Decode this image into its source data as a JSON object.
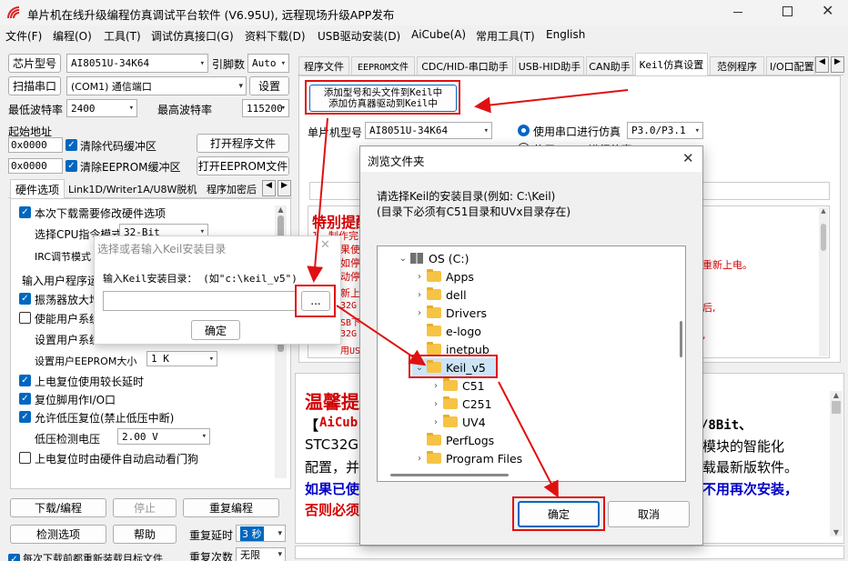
{
  "window": {
    "title": "单片机在线升级编程仿真调试平台软件 (V6.95U), 远程现场升级APP发布"
  },
  "menu": [
    "文件(F)",
    "编程(O)",
    "工具(T)",
    "调试仿真接口(G)",
    "资料下载(D)",
    "USB驱动安装(D)",
    "AiCube(A)",
    "常用工具(T)",
    "English"
  ],
  "left": {
    "chip_label": "芯片型号",
    "chip_value": "AI8051U-34K64",
    "pins_label": "引脚数",
    "pins_value": "Auto",
    "scan_btn": "扫描串口",
    "port_value": "(COM1) 通信端口",
    "settings_btn": "设置",
    "min_baud_label": "最低波特率",
    "min_baud": "2400",
    "max_baud_label": "最高波特率",
    "max_baud": "115200",
    "start_addr_label": "起始地址",
    "addr1": "0x0000",
    "clear_code": "清除代码缓冲区",
    "open_prog": "打开程序文件",
    "addr2": "0x0000",
    "clear_eeprom": "清除EEPROM缓冲区",
    "open_eeprom": "打开EEPROM文件",
    "tabs": [
      "硬件选项",
      "Link1D/Writer1A/U8W脱机",
      "程序加密后"
    ],
    "opts": {
      "o1": "本次下载需要修改硬件选项",
      "cpu_label": "选择CPU指令模式",
      "cpu_value": "32-Bit",
      "irc_label": "IRC调节模式",
      "input_prog": "输入用户程序运",
      "amp": "振荡器放大增",
      "enable_sys": "使能用户系统",
      "set_sys": "设置用户系统",
      "eeprom_label": "设置用户EEPROM大小",
      "eeprom_value": "1 K",
      "delay": "上电复位使用较长延时",
      "reset_io": "复位脚用作I/O口",
      "lvr": "允许低压复位(禁止低压中断)",
      "lv_label": "低压检测电压",
      "lv_value": "2.00 V",
      "wdt": "上电复位时由硬件自动启动看门狗"
    },
    "bottom": {
      "download": "下载/编程",
      "stop": "停止",
      "reprogram": "重复编程",
      "detect": "检测选项",
      "help": "帮助",
      "delay_label": "重复延时",
      "delay_value": "3 秒",
      "count_label": "重复次数",
      "count_value": "无限",
      "reload": "每次下载前都重新装载目标文件"
    }
  },
  "right": {
    "tabs": [
      "程序文件",
      "EEPROM文件",
      "CDC/HID-串口助手",
      "USB-HID助手",
      "CAN助手",
      "Keil仿真设置",
      "范例程序",
      "I/O口配置"
    ],
    "add_btn_l1": "添加型号和头文件到Keil中",
    "add_btn_l2": "添加仿真器驱动到Keil中",
    "mcu_label": "单片机型号",
    "mcu_value": "AI8051U-34K64",
    "radio1": "使用串口进行仿真",
    "radio1_sel": "P3.0/P3.1",
    "radio2": "使用USB口进行仿真",
    "notice_title": "特别提醒",
    "notice_lines": [
      "1、制作完",
      "果使",
      "如停",
      "动停",
      "新上",
      "32G",
      "SB下",
      "32G",
      "用US"
    ],
    "notice_right": [
      "重新上电。",
      "后,",
      ","
    ],
    "tips_title": "温馨提",
    "tips_l1a": "【",
    "tips_l1b": "AiCub",
    "tips_l1c": "/8Bit、",
    "tips_l2a": "STC32G1",
    "tips_l2b": "模块的智能化",
    "tips_l3a": "配置，并",
    "tips_l3b": "载最新版软件。",
    "tips_l4a": "如果已使",
    "tips_l4b": "不用再次安装，",
    "tips_l5": "否则必须"
  },
  "keil_dialog": {
    "title": "选择或者输入Keil安装目录",
    "label": "输入Keil安装目录：  (如\"c:\\keil_v5\")",
    "input_value": "",
    "browse": "...",
    "ok": "确定"
  },
  "browse_dialog": {
    "title": "浏览文件夹",
    "prompt1": "请选择Keil的安装目录(例如: C:\\Keil)",
    "prompt2": "(目录下必须有C51目录和UVx目录存在)",
    "tree": [
      {
        "name": "OS (C:)"
      },
      {
        "name": "Apps"
      },
      {
        "name": "dell"
      },
      {
        "name": "Drivers"
      },
      {
        "name": "e-logo"
      },
      {
        "name": "inetpub"
      },
      {
        "name": "Keil_v5"
      },
      {
        "name": "C51"
      },
      {
        "name": "C251"
      },
      {
        "name": "UV4"
      },
      {
        "name": "PerfLogs"
      },
      {
        "name": "Program Files"
      }
    ],
    "ok": "确定",
    "cancel": "取消"
  }
}
